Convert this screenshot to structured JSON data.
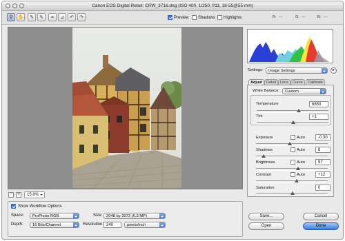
{
  "window": {
    "title": "Canon EOS Digital Rebel:  CRW_3716.dng  (ISO 400, 1/250, f/11, 18-55@55 mm)"
  },
  "toolbar": {
    "tools": [
      {
        "name": "zoom-tool-icon",
        "glyph": "⚲"
      },
      {
        "name": "hand-tool-icon",
        "glyph": "✋"
      },
      {
        "name": "white-balance-tool-icon",
        "glyph": "✎"
      },
      {
        "name": "color-sampler-tool-icon",
        "glyph": "✎"
      },
      {
        "name": "crop-tool-icon",
        "glyph": "⌗"
      },
      {
        "name": "straighten-tool-icon",
        "glyph": "⊿"
      },
      {
        "name": "rotate-left-icon",
        "glyph": "↶"
      },
      {
        "name": "rotate-right-icon",
        "glyph": "↷"
      }
    ],
    "preview_label": "Preview",
    "shadows_label": "Shadows",
    "highlights_label": "Highlights",
    "r_label": "R:",
    "g_label": "G:",
    "b_label": "B:",
    "r_value": "---",
    "g_value": "---",
    "b_value": "---"
  },
  "zoom": {
    "minus": "-",
    "plus": "+",
    "value": "15.8%"
  },
  "workflow": {
    "show_label": "Show Workflow Options",
    "space_label": "Space:",
    "space_value": "ProPhoto RGB",
    "depth_label": "Depth:",
    "depth_value": "16 Bits/Channel",
    "size_label": "Size:",
    "size_value": "2048 by 3072  (6.3 MP)",
    "resolution_label": "Resolution:",
    "resolution_value": "240",
    "resolution_unit": "pixels/inch"
  },
  "settings": {
    "label": "Settings:",
    "value": "Image Settings"
  },
  "tabs": [
    "Adjust",
    "Detail",
    "Lens",
    "Curve",
    "Calibrate"
  ],
  "adjust": {
    "white_balance_label": "White Balance:",
    "white_balance_value": "Custom",
    "temperature_label": "Temperature",
    "temperature_value": "6850",
    "tint_label": "Tint",
    "tint_value": "+1",
    "exposure_label": "Exposure",
    "exposure_value": "-0.30",
    "shadows_label": "Shadows",
    "shadows_value": "8",
    "brightness_label": "Brightness",
    "brightness_value": "97",
    "contrast_label": "Contrast",
    "contrast_value": "+12",
    "saturation_label": "Saturation",
    "saturation_value": "0",
    "auto_label": "Auto"
  },
  "buttons": {
    "save": "Save...",
    "cancel": "Cancel",
    "open": "Open",
    "done": "Done"
  },
  "colors": {
    "accent": "#3b7fd8"
  }
}
